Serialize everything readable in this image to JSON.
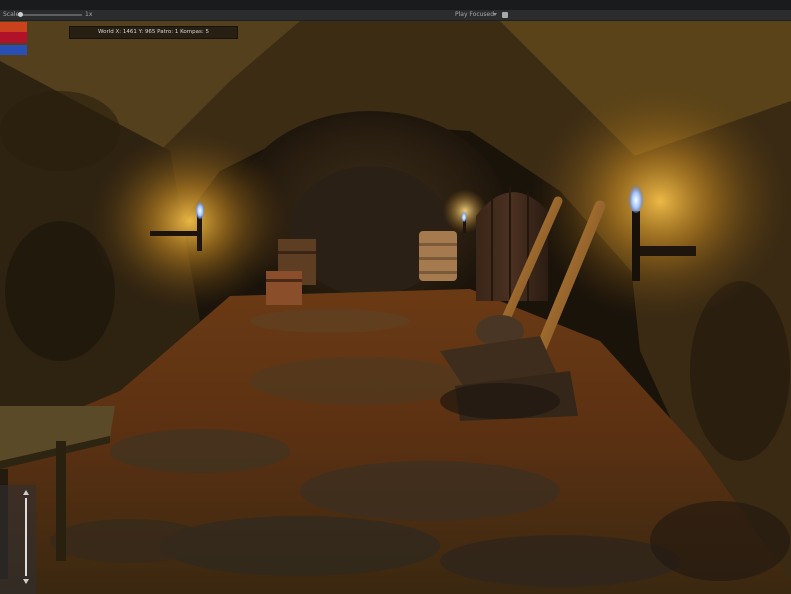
{
  "toolbar": {
    "scale_label": "Scale",
    "scale_value": "1x",
    "play_mode": "Play Focused"
  },
  "hud": {
    "coords": "World X: 1461 Y: 965 Patro: 1 Kompas: 5"
  },
  "swatches": [
    "#c9421c",
    "#b1122a",
    "#2a4fb4"
  ],
  "icons": {
    "play_mode_dropdown": "chevron-down-icon",
    "camera": "camera-icon",
    "slider_up": "arrow-up-icon",
    "slider_down": "arrow-down-icon"
  },
  "colors": {
    "torch_glow": "#f2b33a",
    "cave_rock": "#4a3516",
    "floor_dirt": "#7a3d12",
    "toolbar_bg": "#2b2c2e"
  }
}
